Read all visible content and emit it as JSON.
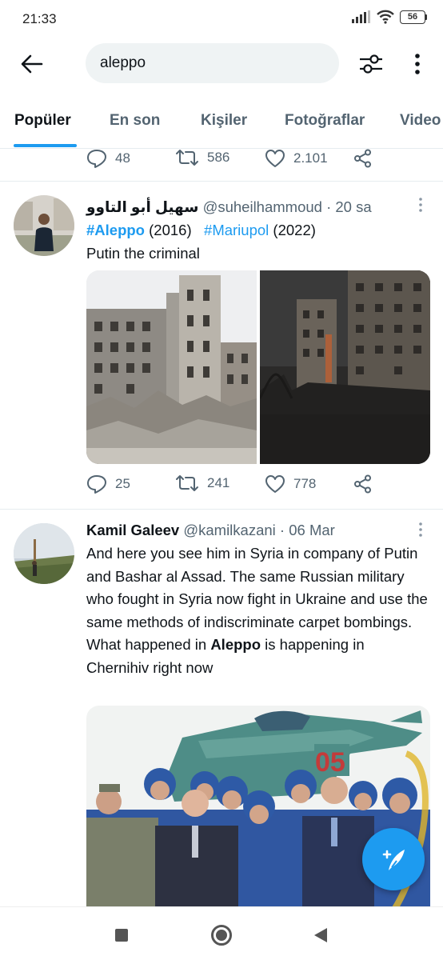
{
  "status_bar": {
    "time": "21:33",
    "battery": "56"
  },
  "search": {
    "query": "aleppo"
  },
  "tabs": [
    {
      "label": "Popüler"
    },
    {
      "label": "En son"
    },
    {
      "label": "Kişiler"
    },
    {
      "label": "Fotoğraflar"
    },
    {
      "label": "Video"
    }
  ],
  "prev_tweet_actions": {
    "replies": "48",
    "retweets": "586",
    "likes": "2.101"
  },
  "tweets": [
    {
      "name": "سهيل أبو التاوو",
      "handle": "@suheilhammoud",
      "time": "· 20 sa",
      "hashtag1": "#Aleppo",
      "year1": " (2016)   ",
      "hashtag2": "#Mariupol",
      "year2": " (2022)",
      "line2": "Putin the criminal",
      "replies": "25",
      "retweets": "241",
      "likes": "778"
    },
    {
      "name": "Kamil Galeev",
      "handle": "@kamilkazani",
      "time": "· 06 Mar",
      "text_before": "And here you see him in Syria in company of Putin and Bashar al Assad. The same Russian military who fought in Syria now fight in Ukraine and use the same methods of indiscriminate carpet bombings. What happened in ",
      "text_highlight": "Aleppo",
      "text_after": " is happening in Chernihiv right now",
      "image_label": "05"
    }
  ],
  "colors": {
    "accent": "#1d9bf0",
    "text": "#0f1419",
    "muted": "#536471"
  }
}
